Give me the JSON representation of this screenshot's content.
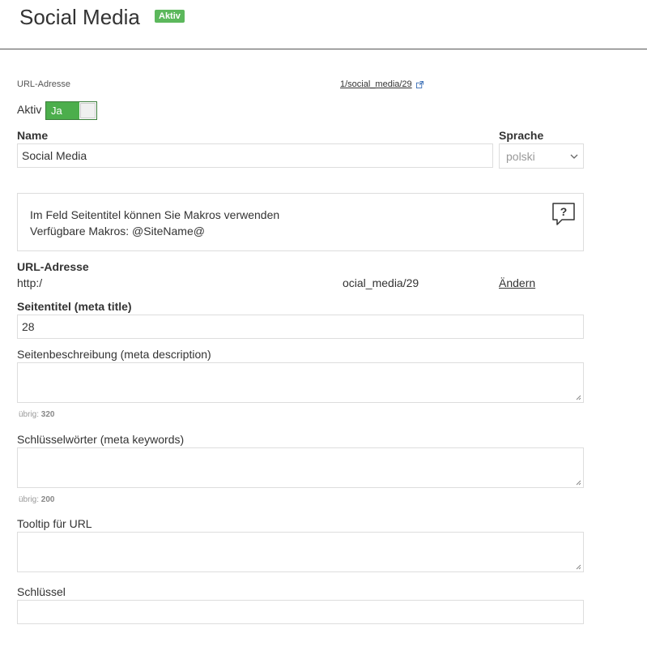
{
  "header": {
    "title": "Social Media",
    "badge": "Aktiv"
  },
  "url_top": {
    "label": "URL-Adresse",
    "link": "1/social_media/29"
  },
  "active": {
    "label": "Aktiv",
    "toggle_value": "Ja"
  },
  "name": {
    "label": "Name",
    "value": "Social Media"
  },
  "language": {
    "label": "Sprache",
    "selected": "polski"
  },
  "info": {
    "line1": "Im Feld Seitentitel können Sie Makros verwenden",
    "line2": "Verfügbare Makros: @SiteName@",
    "help_glyph": "?"
  },
  "url": {
    "label": "URL-Adresse",
    "prefix": "http:/",
    "path": "ocial_media/29",
    "change_link": "Ändern"
  },
  "meta_title": {
    "label": "Seitentitel (meta title)",
    "value": "28"
  },
  "meta_description": {
    "label": "Seitenbeschreibung (meta description)",
    "counter_label": "übrig:",
    "counter_value": "320"
  },
  "meta_keywords": {
    "label": "Schlüsselwörter (meta keywords)",
    "counter_label": "übrig:",
    "counter_value": "200"
  },
  "tooltip": {
    "label": "Tooltip für URL"
  },
  "key": {
    "label": "Schlüssel"
  },
  "colors": {
    "accent_green": "#5cb85c",
    "toggle_green": "#4cae4c"
  }
}
